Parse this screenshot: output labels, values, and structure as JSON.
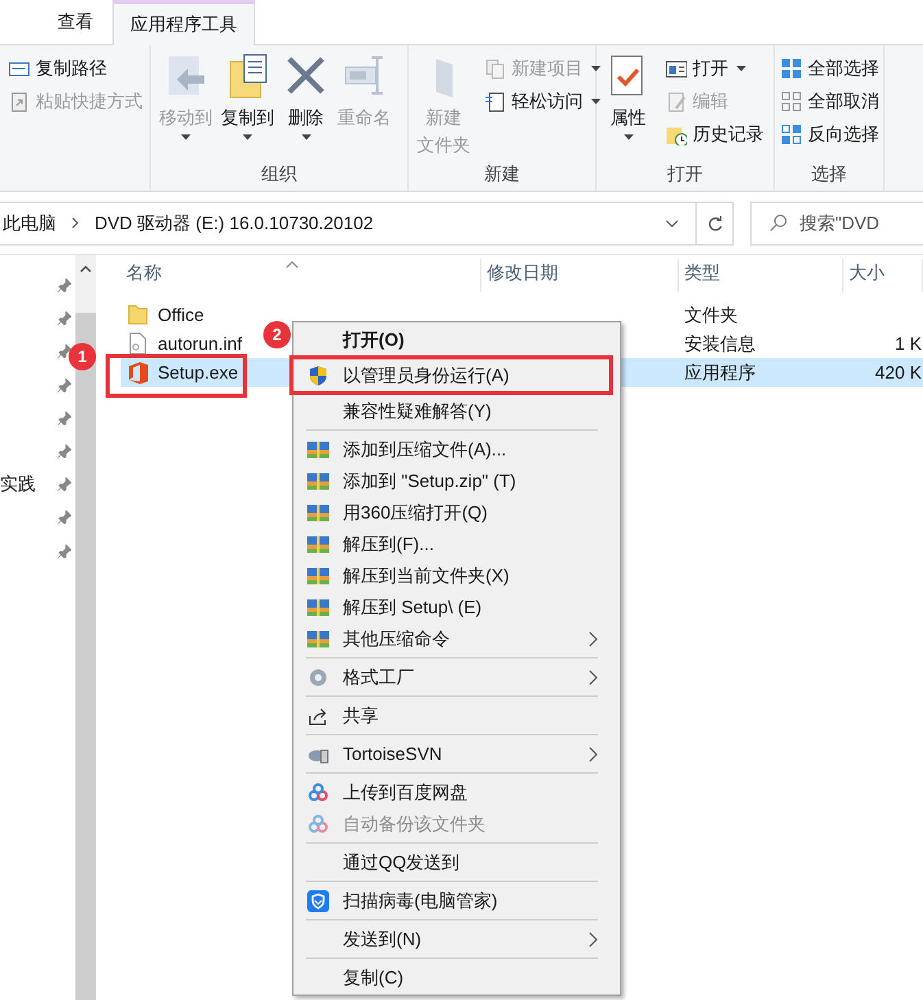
{
  "tabs": [
    {
      "label": "查看",
      "selected": false
    },
    {
      "label": "应用程序工具",
      "selected": true
    }
  ],
  "ribbon": {
    "groups": [
      {
        "small": [
          {
            "label": "复制路径",
            "disabled": false,
            "dropdown": false
          },
          {
            "label": "粘贴快捷方式",
            "disabled": true,
            "dropdown": false
          }
        ]
      },
      {
        "label": "组织",
        "large": [
          {
            "label": "移动到",
            "disabled": true,
            "dropdown": true
          },
          {
            "label": "复制到",
            "disabled": false,
            "dropdown": true
          },
          {
            "label": "删除",
            "disabled": false,
            "dropdown": true
          },
          {
            "label": "重命名",
            "disabled": true,
            "dropdown": false
          }
        ]
      },
      {
        "label": "新建",
        "large": [
          {
            "lines": [
              "新建",
              "文件夹"
            ],
            "disabled": true,
            "dropdown": false
          }
        ],
        "small": [
          {
            "label": "新建项目",
            "disabled": true,
            "dropdown": true
          },
          {
            "label": "轻松访问",
            "disabled": false,
            "dropdown": true
          }
        ]
      },
      {
        "label": "打开",
        "large": [
          {
            "label": "属性",
            "disabled": false,
            "dropdown": true
          }
        ],
        "small": [
          {
            "label": "打开",
            "disabled": false,
            "dropdown": true
          },
          {
            "label": "编辑",
            "disabled": true,
            "dropdown": false
          },
          {
            "label": "历史记录",
            "disabled": false,
            "dropdown": false
          }
        ]
      },
      {
        "label": "选择",
        "small": [
          {
            "label": "全部选择",
            "disabled": false,
            "dropdown": false
          },
          {
            "label": "全部取消",
            "disabled": false,
            "dropdown": false
          },
          {
            "label": "反向选择",
            "disabled": false,
            "dropdown": false
          }
        ]
      }
    ]
  },
  "address": {
    "crumbs": [
      "此电脑",
      "DVD 驱动器 (E:) 16.0.10730.20102"
    ],
    "search_placeholder": "搜索\"DVD"
  },
  "nav": {
    "items": [
      {
        "pinned": true
      },
      {
        "pinned": true
      },
      {
        "pinned": true
      },
      {
        "pinned": true
      },
      {
        "pinned": true
      },
      {
        "pinned": true
      },
      {
        "pinned": true,
        "label": "实践"
      },
      {
        "pinned": true
      },
      {
        "pinned": true
      }
    ]
  },
  "table": {
    "columns": [
      "名称",
      "修改日期",
      "类型",
      "大小"
    ],
    "rows": [
      {
        "kind": "folder",
        "name": "Office",
        "type": "文件夹",
        "selected": false
      },
      {
        "kind": "document",
        "name": "autorun.inf",
        "type": "安装信息",
        "size": "1 K",
        "selected": false
      },
      {
        "kind": "office",
        "name": "Setup.exe",
        "type": "应用程序",
        "size": "420 K",
        "selected": true
      }
    ]
  },
  "context_menu": {
    "items": [
      {
        "kind": "item",
        "label": "打开(O)",
        "bold": true,
        "disabled": false
      },
      {
        "kind": "item",
        "label": "以管理员身份运行(A)",
        "bold": false,
        "disabled": false
      },
      {
        "kind": "item",
        "label": "兼容性疑难解答(Y)",
        "bold": false,
        "disabled": false
      },
      {
        "kind": "separator"
      },
      {
        "kind": "item",
        "label": "添加到压缩文件(A)...",
        "bold": false,
        "disabled": false
      },
      {
        "kind": "item",
        "label": "添加到 \"Setup.zip\" (T)",
        "bold": false,
        "disabled": false
      },
      {
        "kind": "item",
        "label": "用360压缩打开(Q)",
        "bold": false,
        "disabled": false
      },
      {
        "kind": "item",
        "label": "解压到(F)...",
        "bold": false,
        "disabled": false
      },
      {
        "kind": "item",
        "label": "解压到当前文件夹(X)",
        "bold": false,
        "disabled": false
      },
      {
        "kind": "item",
        "label": "解压到 Setup\\ (E)",
        "bold": false,
        "disabled": false
      },
      {
        "kind": "submenu",
        "label": "其他压缩命令",
        "bold": false,
        "disabled": false
      },
      {
        "kind": "separator"
      },
      {
        "kind": "submenu",
        "label": "格式工厂",
        "bold": false,
        "disabled": false
      },
      {
        "kind": "separator"
      },
      {
        "kind": "item",
        "label": "共享",
        "bold": false,
        "disabled": false
      },
      {
        "kind": "separator"
      },
      {
        "kind": "submenu",
        "label": "TortoiseSVN",
        "bold": false,
        "disabled": false
      },
      {
        "kind": "separator"
      },
      {
        "kind": "item",
        "label": "上传到百度网盘",
        "bold": false,
        "disabled": false
      },
      {
        "kind": "item",
        "label": "自动备份该文件夹",
        "bold": false,
        "disabled": true
      },
      {
        "kind": "separator"
      },
      {
        "kind": "item",
        "label": "通过QQ发送到",
        "bold": false,
        "disabled": false
      },
      {
        "kind": "separator"
      },
      {
        "kind": "item",
        "label": "扫描病毒(电脑管家)",
        "bold": false,
        "disabled": false
      },
      {
        "kind": "separator"
      },
      {
        "kind": "submenu",
        "label": "发送到(N)",
        "bold": false,
        "disabled": false
      },
      {
        "kind": "separator"
      },
      {
        "kind": "item",
        "label": "复制(C)",
        "bold": false,
        "disabled": false
      }
    ]
  },
  "annotations": [
    {
      "label": "1"
    },
    {
      "label": "2"
    }
  ]
}
